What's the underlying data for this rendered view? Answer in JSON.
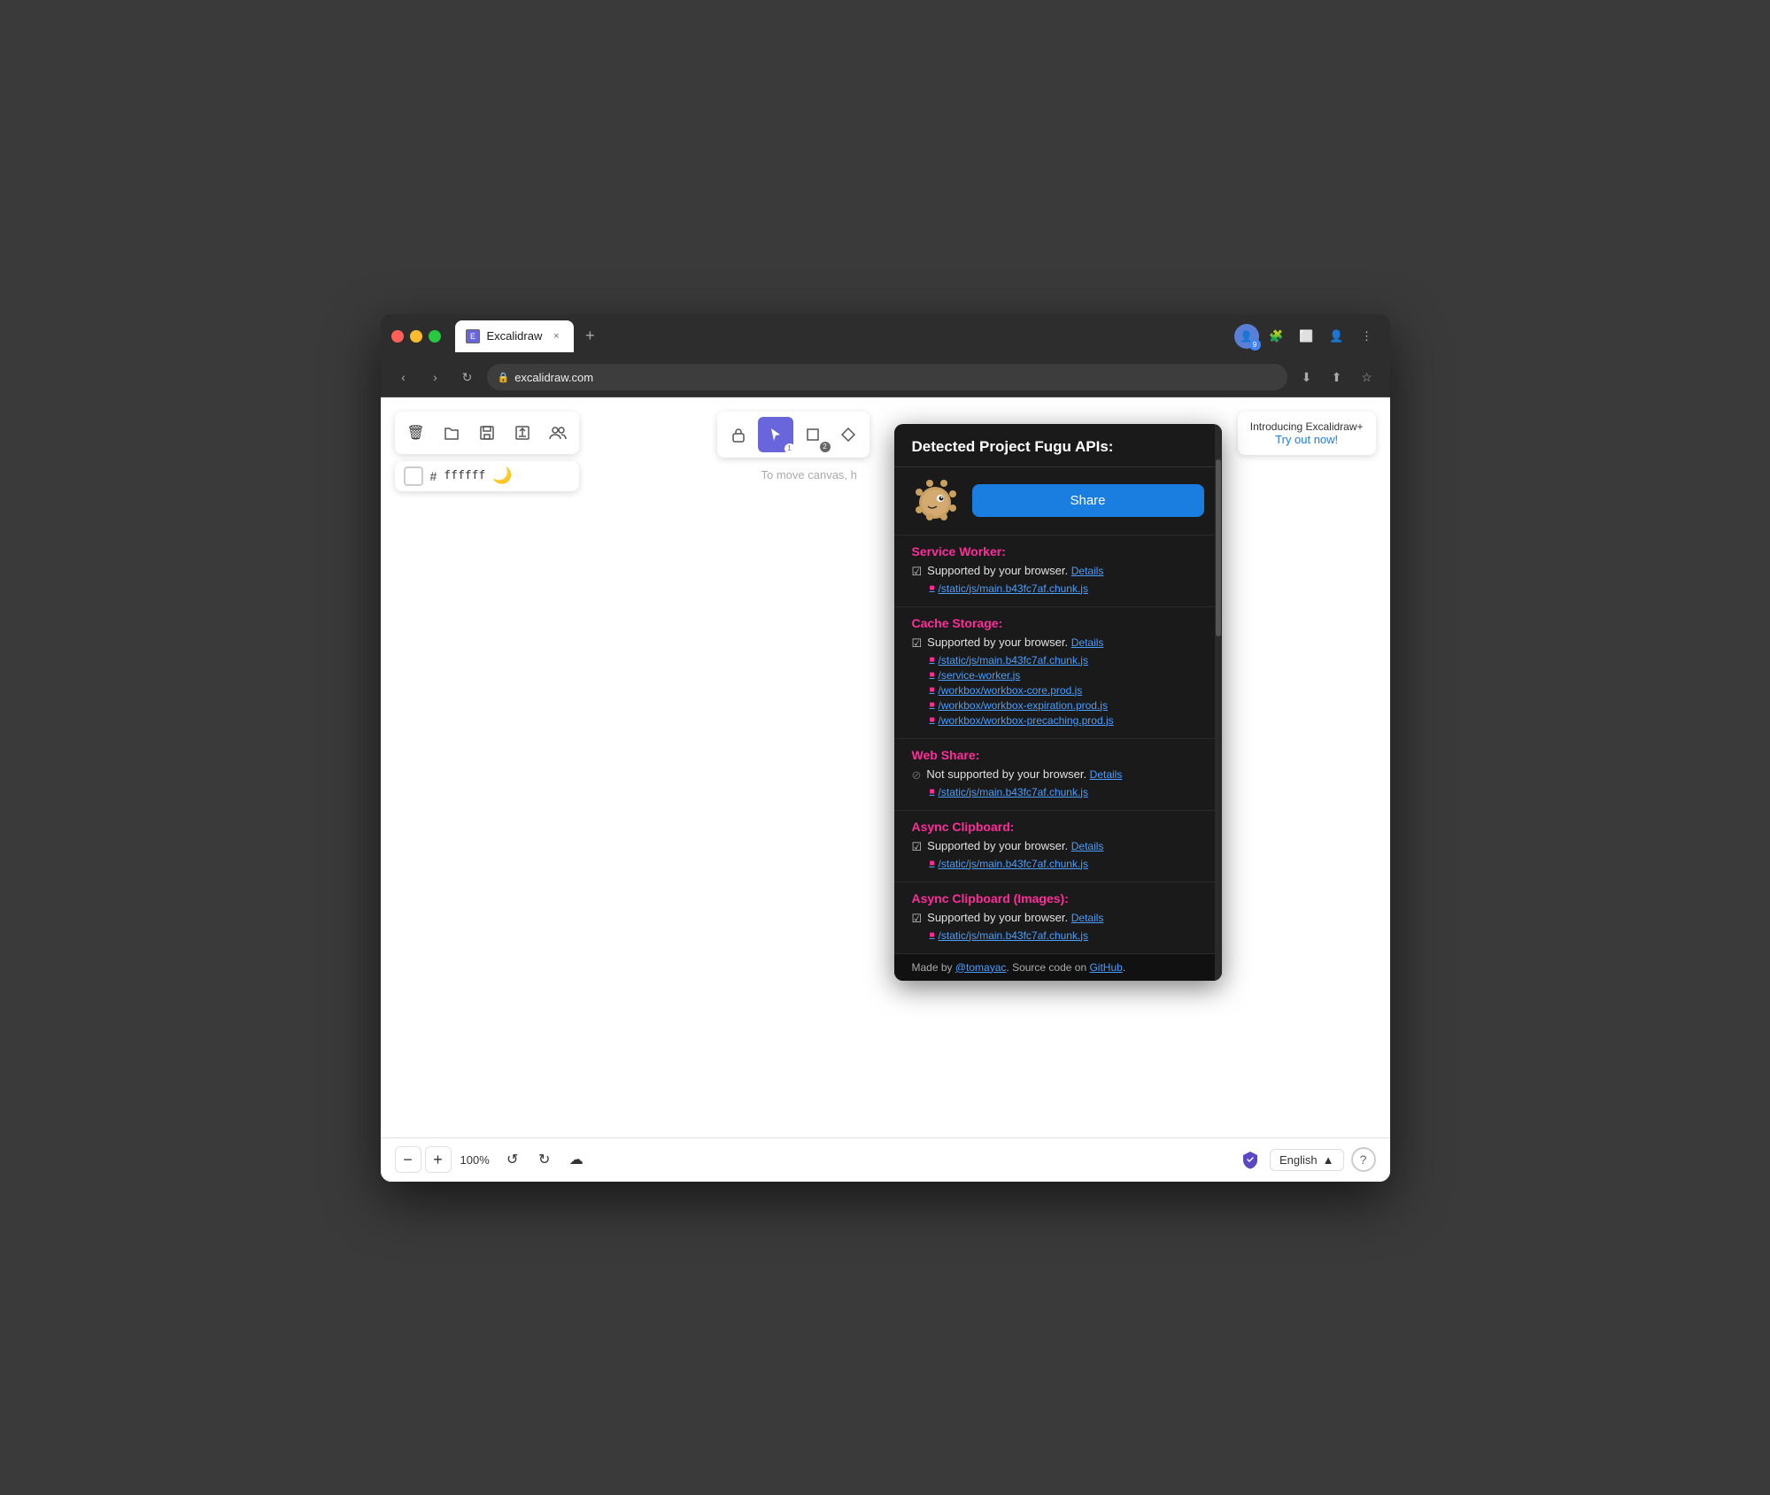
{
  "browser": {
    "tab_title": "Excalidraw",
    "url": "excalidraw.com",
    "close_label": "×",
    "new_tab_label": "+"
  },
  "toolbar": {
    "delete_icon": "🗑",
    "open_icon": "📂",
    "save_icon": "💾",
    "export_icon": "📤",
    "collab_icon": "👥",
    "lock_tool_icon": "🔒",
    "select_icon": "↖",
    "rect_icon": "■",
    "diamond_icon": "◆",
    "color_hex": "ffffff",
    "moon_icon": "🌙",
    "zoom_out": "−",
    "zoom_in": "+",
    "zoom_level": "100%",
    "undo_icon": "↺",
    "redo_icon": "↻",
    "save_state_icon": "☁"
  },
  "intro_panel": {
    "title": "Introducing Excalidraw+",
    "link": "Try out now!"
  },
  "canvas_hint": "To move canvas, h",
  "popup": {
    "title": "Detected Project Fugu APIs:",
    "share_button": "Share",
    "sections": [
      {
        "id": "service-worker",
        "title": "Service Worker:",
        "supported": true,
        "support_text": "Supported by your browser.",
        "details_link": "Details",
        "files": [
          "/static/js/main.b43fc7af.chunk.js"
        ]
      },
      {
        "id": "cache-storage",
        "title": "Cache Storage:",
        "supported": true,
        "support_text": "Supported by your browser.",
        "details_link": "Details",
        "files": [
          "/static/js/main.b43fc7af.chunk.js",
          "/service-worker.js",
          "/workbox/workbox-core.prod.js",
          "/workbox/workbox-expiration.prod.js",
          "/workbox/workbox-precaching.prod.js"
        ]
      },
      {
        "id": "web-share",
        "title": "Web Share:",
        "supported": false,
        "support_text": "Not supported by your browser.",
        "details_link": "Details",
        "files": [
          "/static/js/main.b43fc7af.chunk.js"
        ]
      },
      {
        "id": "async-clipboard",
        "title": "Async Clipboard:",
        "supported": true,
        "support_text": "Supported by your browser.",
        "details_link": "Details",
        "files": [
          "/static/js/main.b43fc7af.chunk.js"
        ]
      },
      {
        "id": "async-clipboard-images",
        "title": "Async Clipboard (Images):",
        "supported": true,
        "support_text": "Supported by your browser.",
        "details_link": "Details",
        "files": [
          "/static/js/main.b43fc7af.chunk.js"
        ]
      }
    ],
    "footer_text": "Made by ",
    "footer_author": "@tomayac",
    "footer_middle": ". Source code on ",
    "footer_github": "GitHub",
    "footer_end": "."
  },
  "language": {
    "selected": "English"
  },
  "nav": {
    "back": "‹",
    "forward": "›",
    "reload": "↻"
  }
}
